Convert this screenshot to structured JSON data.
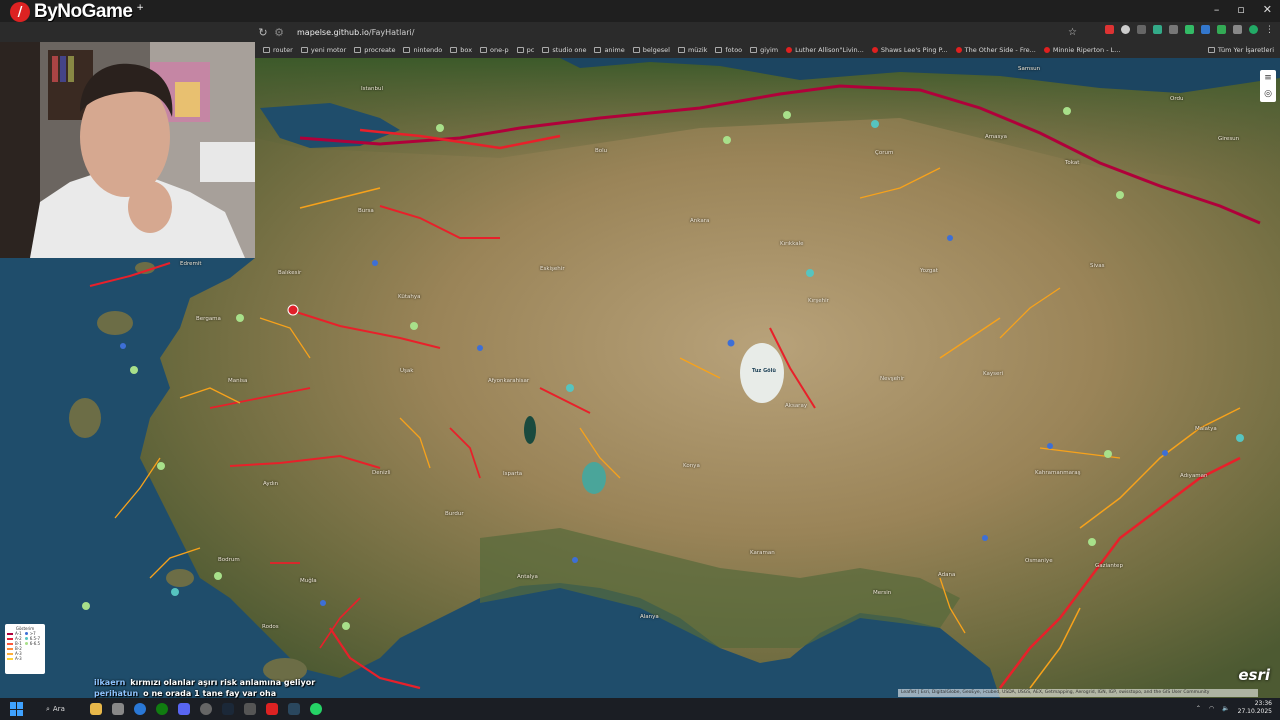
{
  "stream": {
    "logo_text": "ByNoGame",
    "logo_plus": "+"
  },
  "browser": {
    "url_domain": "mapelse.github.io",
    "url_path": "/FayHatlari/",
    "bookmarks": [
      {
        "label": "router",
        "icon": "folder-icon"
      },
      {
        "label": "yeni motor",
        "icon": "folder-icon"
      },
      {
        "label": "procreate",
        "icon": "folder-icon"
      },
      {
        "label": "nintendo",
        "icon": "folder-icon"
      },
      {
        "label": "box",
        "icon": "folder-icon"
      },
      {
        "label": "one-p",
        "icon": "folder-icon"
      },
      {
        "label": "pc",
        "icon": "folder-icon"
      },
      {
        "label": "studio one",
        "icon": "folder-icon"
      },
      {
        "label": "anime",
        "icon": "folder-icon"
      },
      {
        "label": "belgesel",
        "icon": "folder-icon"
      },
      {
        "label": "müzik",
        "icon": "folder-icon"
      },
      {
        "label": "fotoo",
        "icon": "folder-icon"
      },
      {
        "label": "giyim",
        "icon": "folder-icon"
      },
      {
        "label": "Luther Allison\"Livin...",
        "icon": "youtube-icon"
      },
      {
        "label": "Shaws Lee's Ping P...",
        "icon": "youtube-icon"
      },
      {
        "label": "The Other Side - Fre...",
        "icon": "youtube-icon"
      },
      {
        "label": "Minnie Riperton - L...",
        "icon": "youtube-icon"
      }
    ],
    "all_bookmarks_label": "Tüm Yer İşaretleri"
  },
  "map": {
    "cities": [
      {
        "name": "Istanbul"
      },
      {
        "name": "Bursa"
      },
      {
        "name": "Bolu"
      },
      {
        "name": "Ankara"
      },
      {
        "name": "Kırıkkale"
      },
      {
        "name": "Çorum"
      },
      {
        "name": "Amasya"
      },
      {
        "name": "Tokat"
      },
      {
        "name": "Samsun"
      },
      {
        "name": "Ordu"
      },
      {
        "name": "Giresun"
      },
      {
        "name": "Yozgat"
      },
      {
        "name": "Sivas"
      },
      {
        "name": "Kırşehir"
      },
      {
        "name": "Kayseri"
      },
      {
        "name": "Nevşehir"
      },
      {
        "name": "Aksaray"
      },
      {
        "name": "Konya"
      },
      {
        "name": "Karaman"
      },
      {
        "name": "Balıkesir"
      },
      {
        "name": "Kütahya"
      },
      {
        "name": "Eskişehir"
      },
      {
        "name": "Manisa"
      },
      {
        "name": "Uşak"
      },
      {
        "name": "Afyonkarahisar"
      },
      {
        "name": "Isparta"
      },
      {
        "name": "Burdur"
      },
      {
        "name": "Aydın"
      },
      {
        "name": "Muğla"
      },
      {
        "name": "Denizli"
      },
      {
        "name": "Antalya"
      },
      {
        "name": "Alanya"
      },
      {
        "name": "Mersin"
      },
      {
        "name": "Adana"
      },
      {
        "name": "Osmaniye"
      },
      {
        "name": "Gaziantep"
      },
      {
        "name": "Kahramanmaraş"
      },
      {
        "name": "Malatya"
      },
      {
        "name": "Adıyaman"
      },
      {
        "name": "Bodrum"
      },
      {
        "name": "Rodos"
      },
      {
        "name": "Bergama"
      },
      {
        "name": "Edremit"
      }
    ],
    "lake_label": "Tuz Gölü",
    "legend_title": "Gösterim",
    "legend_items": [
      {
        "label": "A-1",
        "color": "#b0003a"
      },
      {
        "label": "A-2",
        "color": "#e0203a"
      },
      {
        "label": "B-1",
        "color": "#ff5a3a"
      },
      {
        "label": "B-2",
        "color": "#ff8a3a"
      },
      {
        "label": "A-3",
        "color": "#ffb03a"
      },
      {
        "label": "A-3",
        "color": "#ffd23a"
      }
    ],
    "legend_mag": [
      ">7",
      "6.5-7",
      "6-6.5"
    ],
    "esri_label": "esri",
    "attribution": "Leaflet | Esri, DigitalGlobe, GeoEye, i-cubed, USDA, USGS, AEX, Getmapping, Aerogrid, IGN, IGP, swisstopo, and the GIS User Community"
  },
  "chat": [
    {
      "user": "ilkaern",
      "message": "kırmızı olanlar aşırı risk anlamına geliyor"
    },
    {
      "user": "perihatun",
      "message": "o ne orada 1 tane fay var oha"
    }
  ],
  "taskbar": {
    "search_label": "Ara",
    "time": "23:36",
    "date": "27.10.2025"
  },
  "colors": {
    "fault_red": "#e8202a",
    "fault_orange": "#f7a21b",
    "fault_darkred": "#b0003a",
    "quake_blue": "#3d6fd6",
    "quake_green": "#a8e08a"
  }
}
